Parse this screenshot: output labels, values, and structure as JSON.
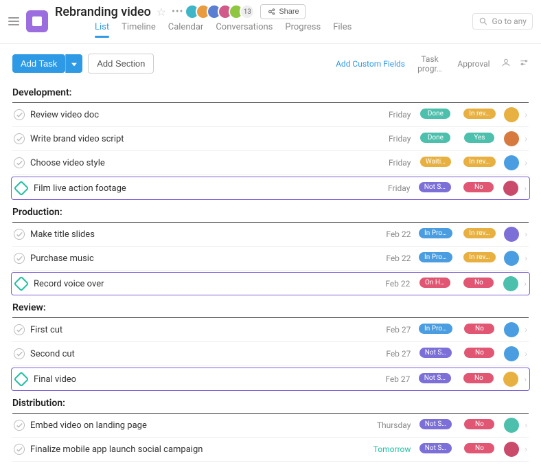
{
  "header": {
    "project_title": "Rebranding video",
    "avatar_count": "13",
    "share_label": "Share",
    "search_placeholder": "Go to any"
  },
  "tabs": [
    "List",
    "Timeline",
    "Calendar",
    "Conversations",
    "Progress",
    "Files"
  ],
  "active_tab": 0,
  "toolbar": {
    "add_task": "Add Task",
    "add_section": "Add Section",
    "add_custom_fields": "Add Custom Fields",
    "col_progress": "Task progr…",
    "col_approval": "Approval"
  },
  "colors": {
    "done": "#4cc0ac",
    "waiting": "#e8b040",
    "inprogress": "#4a9de0",
    "notstarted": "#7c6fd8",
    "onhold": "#e05673",
    "no": "#e05673",
    "yes": "#4cc0ac",
    "inreview": "#e8b040"
  },
  "avatars_header": [
    "#3fb5c8",
    "#e89c3f",
    "#5a7ed1",
    "#d15a8a",
    "#8ec63f"
  ],
  "sections": [
    {
      "title": "Development:",
      "tasks": [
        {
          "name": "Review video doc",
          "due": "Friday",
          "progress": {
            "text": "Done",
            "color": "done"
          },
          "approval": {
            "text": "In rev…",
            "color": "inreview"
          },
          "assignee": "#e8b040",
          "milestone": false,
          "highlight": false
        },
        {
          "name": "Write brand video script",
          "due": "Friday",
          "progress": {
            "text": "Done",
            "color": "done"
          },
          "approval": {
            "text": "Yes",
            "color": "yes"
          },
          "assignee": "#d67a3f",
          "milestone": false,
          "highlight": false
        },
        {
          "name": "Choose video style",
          "due": "Friday",
          "progress": {
            "text": "Waiti…",
            "color": "waiting"
          },
          "approval": {
            "text": "In rev…",
            "color": "inreview"
          },
          "assignee": "#4a9de0",
          "milestone": false,
          "highlight": false
        },
        {
          "name": "Film live action footage",
          "due": "Friday",
          "progress": {
            "text": "Not S…",
            "color": "notstarted"
          },
          "approval": {
            "text": "No",
            "color": "no"
          },
          "assignee": "#c94a6a",
          "milestone": true,
          "highlight": true
        }
      ]
    },
    {
      "title": "Production:",
      "tasks": [
        {
          "name": "Make title slides",
          "due": "Feb 22",
          "progress": {
            "text": "In Pro…",
            "color": "inprogress"
          },
          "approval": {
            "text": "In rev…",
            "color": "inreview"
          },
          "assignee": "#7c6fd8",
          "milestone": false,
          "highlight": false
        },
        {
          "name": "Purchase music",
          "due": "Feb 22",
          "progress": {
            "text": "In Pro…",
            "color": "inprogress"
          },
          "approval": {
            "text": "In rev…",
            "color": "inreview"
          },
          "assignee": "#4a9de0",
          "milestone": false,
          "highlight": false
        },
        {
          "name": "Record voice over",
          "due": "Feb 22",
          "progress": {
            "text": "On H…",
            "color": "onhold"
          },
          "approval": {
            "text": "No",
            "color": "no"
          },
          "assignee": "#4cc0ac",
          "milestone": true,
          "highlight": true
        }
      ]
    },
    {
      "title": "Review:",
      "tasks": [
        {
          "name": "First cut",
          "due": "Feb 27",
          "progress": {
            "text": "In Pro…",
            "color": "inprogress"
          },
          "approval": {
            "text": "No",
            "color": "no"
          },
          "assignee": "#4a9de0",
          "milestone": false,
          "highlight": false
        },
        {
          "name": "Second cut",
          "due": "Feb 27",
          "progress": {
            "text": "Not S…",
            "color": "notstarted"
          },
          "approval": {
            "text": "No",
            "color": "no"
          },
          "assignee": "#4a9de0",
          "milestone": false,
          "highlight": false
        },
        {
          "name": "Final video",
          "due": "Feb 27",
          "progress": {
            "text": "Not S…",
            "color": "notstarted"
          },
          "approval": {
            "text": "No",
            "color": "no"
          },
          "assignee": "#e8b040",
          "milestone": true,
          "highlight": true
        }
      ]
    },
    {
      "title": "Distribution:",
      "tasks": [
        {
          "name": "Embed video on landing page",
          "due": "Thursday",
          "progress": {
            "text": "Not S…",
            "color": "notstarted"
          },
          "approval": {
            "text": "No",
            "color": "no"
          },
          "assignee": "#4cc0ac",
          "milestone": false,
          "highlight": false
        },
        {
          "name": "Finalize mobile app launch social campaign",
          "due": "Tomorrow",
          "due_color": "green",
          "progress": {
            "text": "Not S…",
            "color": "notstarted"
          },
          "approval": {
            "text": "No",
            "color": "no"
          },
          "assignee": "#c94a6a",
          "milestone": false,
          "highlight": false
        }
      ]
    }
  ]
}
